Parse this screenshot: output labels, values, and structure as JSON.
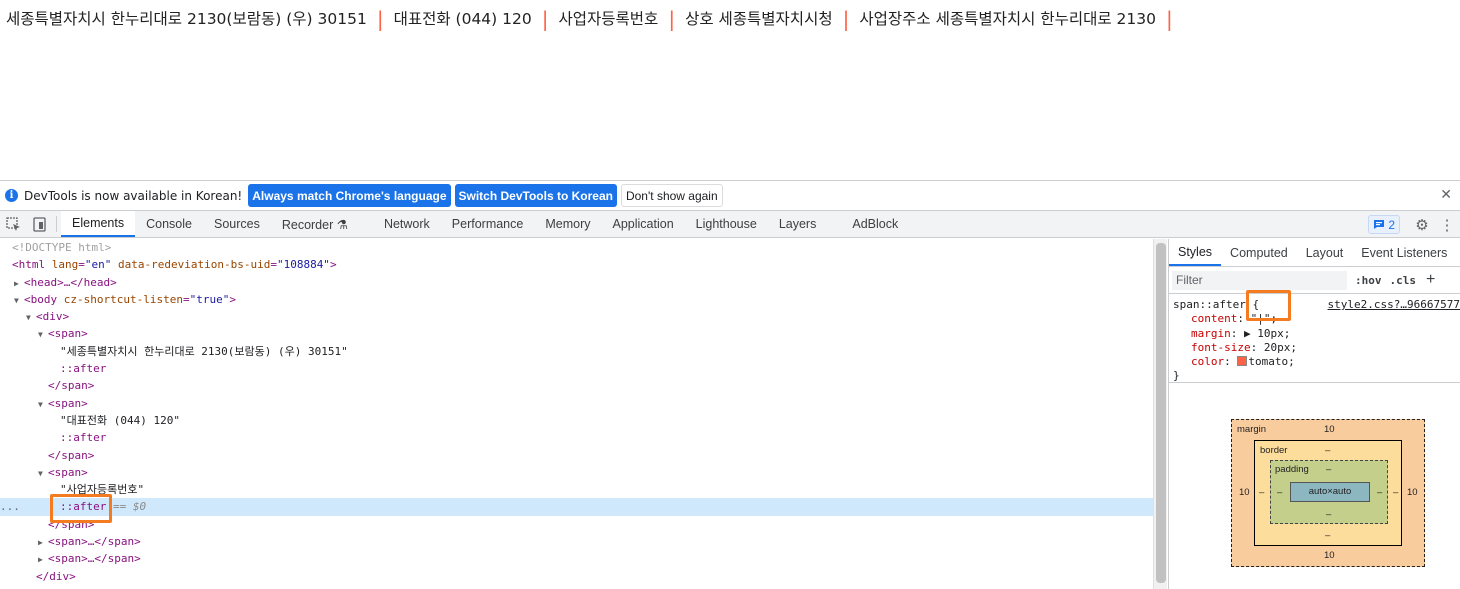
{
  "page": {
    "items": [
      "세종특별자치시 한누리대로 2130(보람동) (우) 30151",
      "대표전화 (044) 120",
      "사업자등록번호",
      "상호 세종특별자치시청",
      "사업장주소 세종특별자치시 한누리대로 2130"
    ],
    "separator": "|"
  },
  "infobar": {
    "icon": "info-icon",
    "text": "DevTools is now available in Korean!",
    "btn_match": "Always match Chrome's language",
    "btn_switch": "Switch DevTools to Korean",
    "btn_dont_show": "Don't show again"
  },
  "tabs": {
    "items": [
      "Elements",
      "Console",
      "Sources",
      "Recorder ⚗",
      "Network",
      "Performance",
      "Memory",
      "Application",
      "Lighthouse",
      "Layers",
      "AdBlock"
    ],
    "active": "Elements",
    "issues_count": "2"
  },
  "dom": {
    "doctype": "<!DOCTYPE html>",
    "html_open_tag": "<html",
    "html_attr_lang_name": "lang",
    "html_attr_lang_val": "\"en\"",
    "html_attr_uid_name": "data-redeviation-bs-uid",
    "html_attr_uid_val": "\"108884\"",
    "head_collapsed": "<head>…</head>",
    "body_open_tag": "<body",
    "body_attr_name": "cz-shortcut-listen",
    "body_attr_val": "\"true\"",
    "div_open": "<div>",
    "span_open": "<span>",
    "span_close": "</span>",
    "span_collapsed": "<span>…</span>",
    "div_close": "</div>",
    "text1": "\"세종특별자치시 한누리대로 2130(보람동) (우) 30151\"",
    "text2": "\"대표전화 (044) 120\"",
    "text3": "\"사업자등록번호\"",
    "after": "::after",
    "dollar": "== $0",
    "dots": "..."
  },
  "sidebar": {
    "subtabs": [
      "Styles",
      "Computed",
      "Layout",
      "Event Listeners"
    ],
    "active_subtab": "Styles",
    "filter_placeholder": "Filter",
    "hov": ":hov",
    "cls": ".cls",
    "plus": "+",
    "rule": {
      "selector": "span::after {",
      "source": "style2.css?…96667577",
      "props": [
        {
          "name": "content",
          "value": "\"|\";"
        },
        {
          "name": "margin",
          "value": "▶ 10px;"
        },
        {
          "name": "font-size",
          "value": "20px;"
        },
        {
          "name": "color",
          "value": "tomato;"
        }
      ],
      "close": "}",
      "color_swatch": "#ff6347"
    },
    "box_model": {
      "margin_label": "margin",
      "border_label": "border",
      "padding_label": "padding",
      "content": "auto×auto",
      "margin_top": "10",
      "margin_bottom": "10",
      "margin_left": "10",
      "margin_right": "10",
      "border_val": "–",
      "padding_val": "–"
    }
  },
  "colors": {
    "separator": "#ff6347",
    "accent": "#1a73e8",
    "highlight": "#f47b20",
    "selected_row": "#cfe8fc"
  }
}
